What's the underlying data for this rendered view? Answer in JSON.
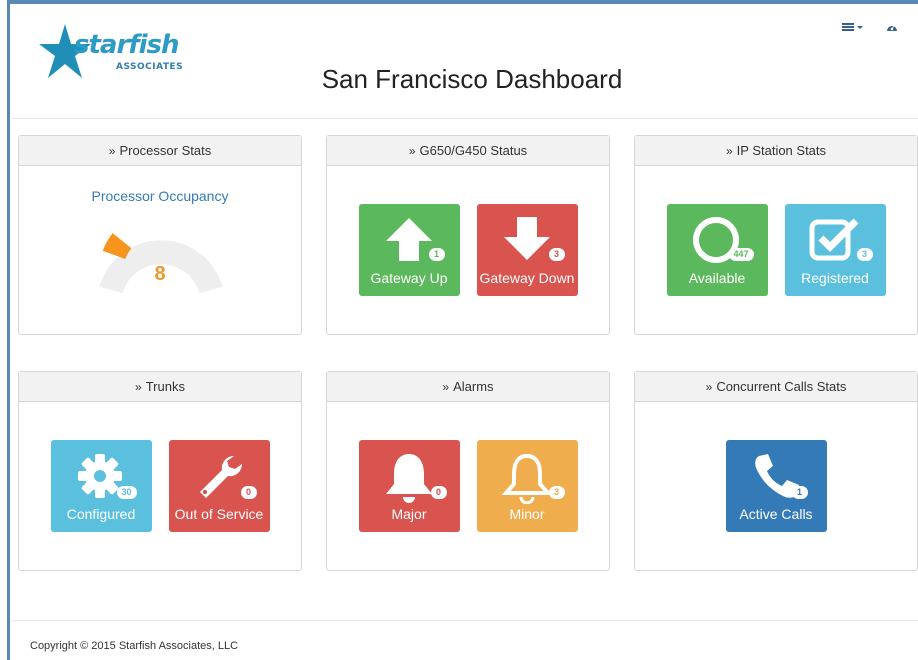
{
  "logo": {
    "word": "starfish",
    "sub": "ASSOCIATES"
  },
  "header": {
    "title": "San Francisco Dashboard"
  },
  "nav": {
    "menu_icon": "list-dropdown-icon",
    "dashboard_icon": "dashboard-icon"
  },
  "panels": {
    "processor": {
      "title": "Processor Stats",
      "gauge_label": "Processor Occupancy",
      "value": "8",
      "gauge_fraction": 0.08
    },
    "gateway": {
      "title": "G650/G450 Status",
      "up": {
        "label": "Gateway Up",
        "count": "1"
      },
      "down": {
        "label": "Gateway Down",
        "count": "3"
      }
    },
    "ipstation": {
      "title": "IP Station Stats",
      "available": {
        "label": "Available",
        "count": "447"
      },
      "registered": {
        "label": "Registered",
        "count": "3"
      }
    },
    "trunks": {
      "title": "Trunks",
      "configured": {
        "label": "Configured",
        "count": "30"
      },
      "oos": {
        "label": "Out of Service",
        "count": "0"
      }
    },
    "alarms": {
      "title": "Alarms",
      "major": {
        "label": "Major",
        "count": "0"
      },
      "minor": {
        "label": "Minor",
        "count": "3"
      }
    },
    "calls": {
      "title": "Concurrent Calls Stats",
      "active": {
        "label": "Active Calls",
        "count": "1"
      }
    }
  },
  "colors": {
    "green": "#5cb85c",
    "red": "#d9534f",
    "cyan": "#5bc0de",
    "orange": "#f0ad4e",
    "blue": "#337ab7",
    "gauge_fill": "#f7941e",
    "gauge_track": "#eeeeee"
  },
  "footer": {
    "copyright": "Copyright © 2015 Starfish Associates, LLC"
  }
}
